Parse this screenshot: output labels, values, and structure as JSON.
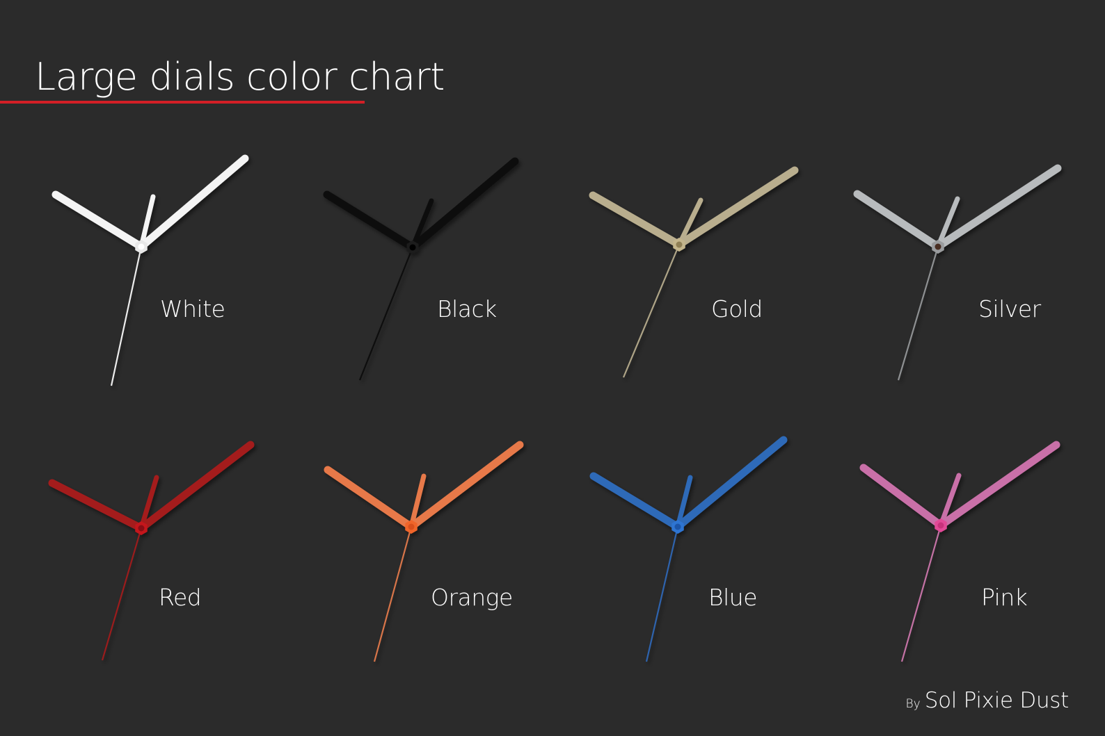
{
  "title": "Large dials color chart",
  "accent_color": "#d31f26",
  "background_color": "#2b2b2b",
  "swatches": [
    {
      "label": "White",
      "color": "#f4f4f4",
      "second_color": "#ececec",
      "cap_color": "#e8e8e8",
      "center_color": "#ffffff"
    },
    {
      "label": "Black",
      "color": "#0b0b0b",
      "second_color": "#111111",
      "cap_color": "#1a1a1a",
      "center_color": "#000000"
    },
    {
      "label": "Gold",
      "color": "#b9ae8e",
      "second_color": "#aea487",
      "cap_color": "#c3b58c",
      "center_color": "#8f7f54"
    },
    {
      "label": "Silver",
      "color": "#b8bbbd",
      "second_color": "#8e9092",
      "cap_color": "#9a9c9e",
      "center_color": "#4a2d22"
    },
    {
      "label": "Red",
      "color": "#a41c1f",
      "second_color": "#9b1b1e",
      "cap_color": "#c4171d",
      "center_color": "#8a0f12"
    },
    {
      "label": "Orange",
      "color": "#e7794a",
      "second_color": "#d8754a",
      "cap_color": "#f0652a",
      "center_color": "#d9501a"
    },
    {
      "label": "Blue",
      "color": "#2f6ab8",
      "second_color": "#2f63ad",
      "cap_color": "#2e74d2",
      "center_color": "#1e55a8"
    },
    {
      "label": "Pink",
      "color": "#c970a8",
      "second_color": "#c472a5",
      "cap_color": "#e24a97",
      "center_color": "#c8307c"
    }
  ],
  "credit": {
    "by": "By",
    "brand": "Sol Pixie Dust"
  }
}
